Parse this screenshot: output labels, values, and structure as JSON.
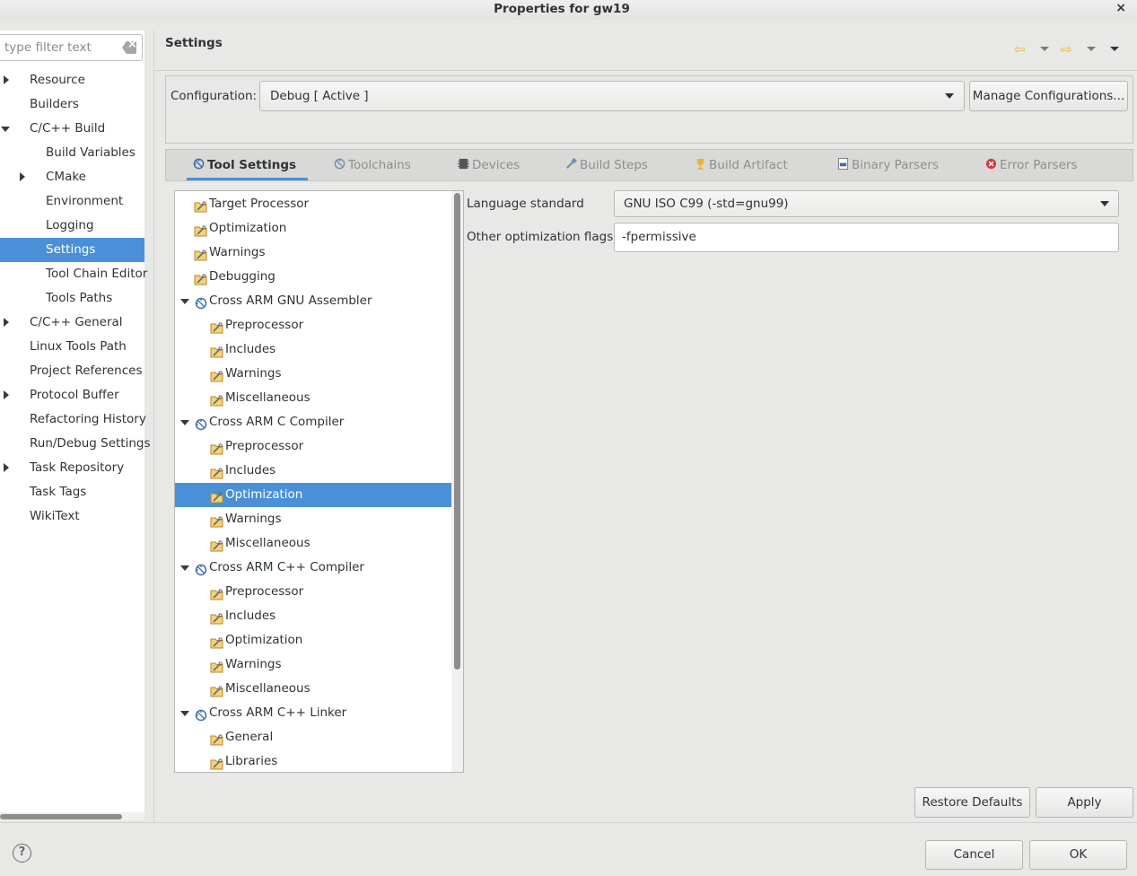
{
  "window": {
    "title": "Properties for gw19",
    "close_icon": "×"
  },
  "filter": {
    "placeholder": "type filter text"
  },
  "nav": {
    "items": [
      {
        "label": "Resource",
        "expander": "collapsed",
        "level": 0
      },
      {
        "label": "Builders",
        "expander": "none",
        "level": 0
      },
      {
        "label": "C/C++ Build",
        "expander": "expanded",
        "level": 0
      },
      {
        "label": "Build Variables",
        "expander": "none",
        "level": 1
      },
      {
        "label": "CMake",
        "expander": "collapsed",
        "level": 1
      },
      {
        "label": "Environment",
        "expander": "none",
        "level": 1
      },
      {
        "label": "Logging",
        "expander": "none",
        "level": 1
      },
      {
        "label": "Settings",
        "expander": "none",
        "level": 1,
        "selected": true
      },
      {
        "label": "Tool Chain Editor",
        "expander": "none",
        "level": 1
      },
      {
        "label": "Tools Paths",
        "expander": "none",
        "level": 1
      },
      {
        "label": "C/C++ General",
        "expander": "collapsed",
        "level": 0
      },
      {
        "label": "Linux Tools Path",
        "expander": "none",
        "level": 0
      },
      {
        "label": "Project References",
        "expander": "none",
        "level": 0
      },
      {
        "label": "Protocol Buffer",
        "expander": "collapsed",
        "level": 0
      },
      {
        "label": "Refactoring History",
        "expander": "none",
        "level": 0
      },
      {
        "label": "Run/Debug Settings",
        "expander": "none",
        "level": 0
      },
      {
        "label": "Task Repository",
        "expander": "collapsed",
        "level": 0
      },
      {
        "label": "Task Tags",
        "expander": "none",
        "level": 0
      },
      {
        "label": "WikiText",
        "expander": "none",
        "level": 0
      }
    ]
  },
  "page": {
    "heading": "Settings",
    "back_icon": "⇦",
    "forward_icon": "⇨"
  },
  "configuration": {
    "label": "Configuration:",
    "selected": "Debug  [ Active ]",
    "manage_label": "Manage Configurations..."
  },
  "tabs": [
    {
      "label": "Tool Settings",
      "icon": "tool-settings-icon",
      "active": true
    },
    {
      "label": "Toolchains",
      "icon": "toolchains-icon",
      "active": false
    },
    {
      "label": "Devices",
      "icon": "devices-icon",
      "active": false
    },
    {
      "label": "Build Steps",
      "icon": "build-steps-icon",
      "active": false
    },
    {
      "label": "Build Artifact",
      "icon": "build-artifact-icon",
      "active": false
    },
    {
      "label": "Binary Parsers",
      "icon": "binary-parsers-icon",
      "active": false
    },
    {
      "label": "Error Parsers",
      "icon": "error-parsers-icon",
      "active": false
    }
  ],
  "tool_tree": [
    {
      "label": "Target Processor",
      "kind": "option",
      "level": 0
    },
    {
      "label": "Optimization",
      "kind": "option",
      "level": 0
    },
    {
      "label": "Warnings",
      "kind": "option",
      "level": 0
    },
    {
      "label": "Debugging",
      "kind": "option",
      "level": 0
    },
    {
      "label": "Cross ARM GNU Assembler",
      "kind": "tool",
      "level": 0
    },
    {
      "label": "Preprocessor",
      "kind": "option",
      "level": 1
    },
    {
      "label": "Includes",
      "kind": "option",
      "level": 1
    },
    {
      "label": "Warnings",
      "kind": "option",
      "level": 1
    },
    {
      "label": "Miscellaneous",
      "kind": "option",
      "level": 1
    },
    {
      "label": "Cross ARM C Compiler",
      "kind": "tool",
      "level": 0
    },
    {
      "label": "Preprocessor",
      "kind": "option",
      "level": 1
    },
    {
      "label": "Includes",
      "kind": "option",
      "level": 1
    },
    {
      "label": "Optimization",
      "kind": "option",
      "level": 1,
      "selected": true
    },
    {
      "label": "Warnings",
      "kind": "option",
      "level": 1
    },
    {
      "label": "Miscellaneous",
      "kind": "option",
      "level": 1
    },
    {
      "label": "Cross ARM C++ Compiler",
      "kind": "tool",
      "level": 0
    },
    {
      "label": "Preprocessor",
      "kind": "option",
      "level": 1
    },
    {
      "label": "Includes",
      "kind": "option",
      "level": 1
    },
    {
      "label": "Optimization",
      "kind": "option",
      "level": 1
    },
    {
      "label": "Warnings",
      "kind": "option",
      "level": 1
    },
    {
      "label": "Miscellaneous",
      "kind": "option",
      "level": 1
    },
    {
      "label": "Cross ARM C++ Linker",
      "kind": "tool",
      "level": 0
    },
    {
      "label": "General",
      "kind": "option",
      "level": 1
    },
    {
      "label": "Libraries",
      "kind": "option",
      "level": 1
    }
  ],
  "options": {
    "language_standard_label": "Language standard",
    "language_standard_value": "GNU ISO C99 (-std=gnu99)",
    "other_flags_label": "Other optimization flags",
    "other_flags_value": "-fpermissive"
  },
  "buttons": {
    "restore_defaults": "Restore Defaults",
    "apply": "Apply",
    "cancel": "Cancel",
    "ok": "OK"
  },
  "help": {
    "glyph": "?"
  },
  "colors": {
    "selection": "#4a90d9",
    "folder": "#e6b53c",
    "tool": "#3d6ea8"
  }
}
